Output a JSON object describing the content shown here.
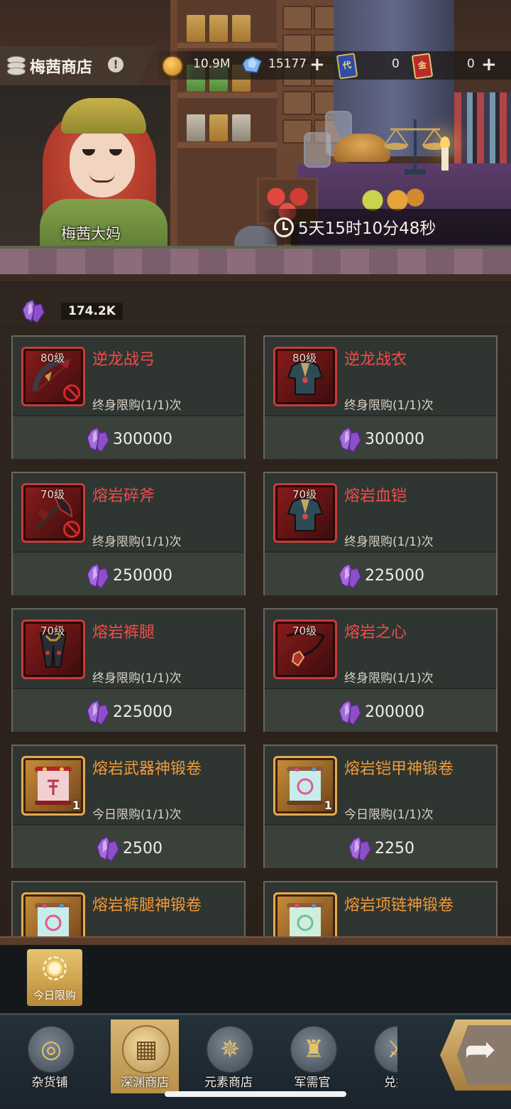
{
  "header": {
    "shop_name": "梅茜商店",
    "info_icon": "!",
    "npc_name": "梅茜大妈",
    "timer": "5天15时10分48秒"
  },
  "currencies": {
    "gold": "10.9M",
    "gems": "15177",
    "blue_card": "0",
    "red_card": "0",
    "blue_card_glyph": "代",
    "red_card_glyph": "金",
    "plus": "+"
  },
  "balance": "174.2K",
  "items": [
    {
      "name": "逆龙战弓",
      "level": "80级",
      "limit": "终身限购(1/1)次",
      "price": "300000",
      "frame": "red",
      "name_color": "red",
      "locked": true,
      "art": "bow"
    },
    {
      "name": "逆龙战衣",
      "level": "80级",
      "limit": "终身限购(1/1)次",
      "price": "300000",
      "frame": "red",
      "name_color": "red",
      "locked": false,
      "art": "armor"
    },
    {
      "name": "熔岩碎斧",
      "level": "70级",
      "limit": "终身限购(1/1)次",
      "price": "250000",
      "frame": "red",
      "name_color": "red",
      "locked": true,
      "art": "axe"
    },
    {
      "name": "熔岩血铠",
      "level": "70级",
      "limit": "终身限购(1/1)次",
      "price": "225000",
      "frame": "red",
      "name_color": "red",
      "locked": false,
      "art": "armor"
    },
    {
      "name": "熔岩裤腿",
      "level": "70级",
      "limit": "终身限购(1/1)次",
      "price": "225000",
      "frame": "red",
      "name_color": "red",
      "locked": false,
      "art": "legs"
    },
    {
      "name": "熔岩之心",
      "level": "70级",
      "limit": "终身限购(1/1)次",
      "price": "200000",
      "frame": "red",
      "name_color": "red",
      "locked": false,
      "art": "necklace"
    },
    {
      "name": "熔岩武器神锻卷",
      "level": "",
      "qty": "1",
      "limit": "今日限购(1/1)次",
      "price": "2500",
      "frame": "gold",
      "name_color": "orange",
      "locked": false,
      "art": "scroll-pink"
    },
    {
      "name": "熔岩铠甲神锻卷",
      "level": "",
      "qty": "1",
      "limit": "今日限购(1/1)次",
      "price": "2250",
      "frame": "gold",
      "name_color": "orange",
      "locked": false,
      "art": "scroll-cyan"
    },
    {
      "name": "熔岩裤腿神锻卷",
      "level": "",
      "qty": "",
      "limit": "",
      "price": "",
      "frame": "gold",
      "name_color": "orange",
      "locked": false,
      "art": "scroll-cyan"
    },
    {
      "name": "熔岩项链神锻卷",
      "level": "",
      "qty": "",
      "limit": "",
      "price": "",
      "frame": "gold",
      "name_color": "orange",
      "locked": false,
      "art": "scroll-green"
    }
  ],
  "daily_tab": "今日限购",
  "nav": [
    {
      "label": "杂货铺",
      "icon": "coins-icon",
      "active": false
    },
    {
      "label": "深渊商店",
      "icon": "abyss-shop-icon",
      "active": true
    },
    {
      "label": "元素商店",
      "icon": "element-star-icon",
      "active": false
    },
    {
      "label": "军需官",
      "icon": "helmet-icon",
      "active": false
    },
    {
      "label": "兑换",
      "icon": "exchange-icon",
      "active": false
    }
  ],
  "colors": {
    "name_red": "#ef4d4d",
    "name_orange": "#f09a3a",
    "accent_gold": "#d8b676",
    "crystal_purple": "#8d4fc9"
  }
}
